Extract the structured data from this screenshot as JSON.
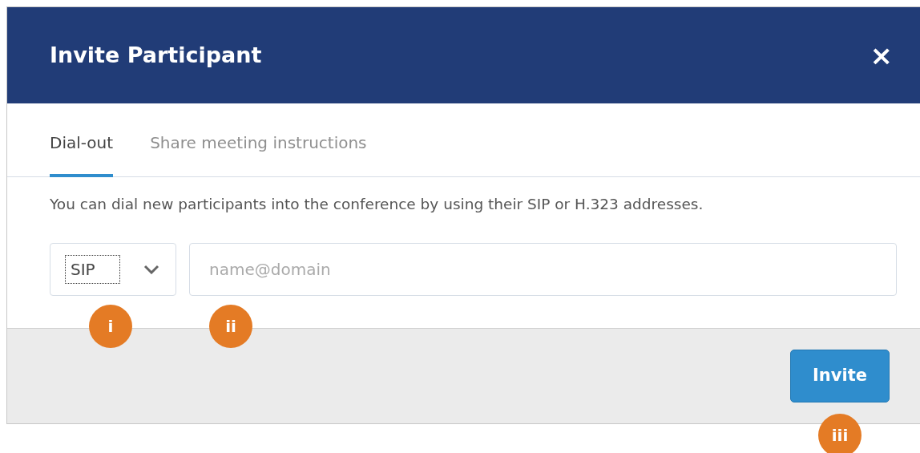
{
  "dialog": {
    "title": "Invite Participant",
    "close": "×"
  },
  "tabs": [
    {
      "label": "Dial-out",
      "selected": true
    },
    {
      "label": "Share meeting instructions",
      "selected": false
    }
  ],
  "description": "You can dial new participants into the conference by using their SIP or H.323 addresses.",
  "protocol_select": {
    "value": "SIP",
    "callout": "i"
  },
  "address_field": {
    "placeholder": "name@domain",
    "callout": "ii"
  },
  "invite_button": {
    "label": "Invite",
    "callout": "iii"
  }
}
